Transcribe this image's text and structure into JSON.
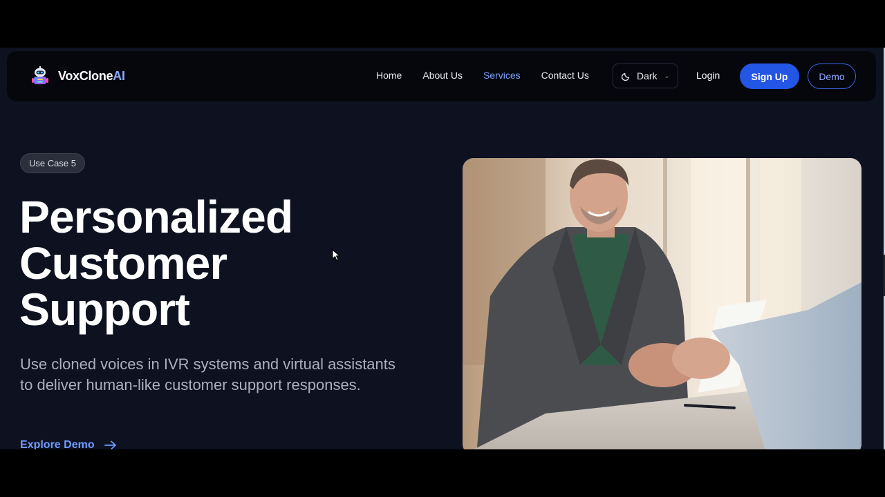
{
  "brand": {
    "name_main": "VoxClone",
    "name_accent": "AI"
  },
  "nav": {
    "links": [
      "Home",
      "About Us",
      "Services",
      "Contact Us"
    ],
    "active": "Services",
    "theme": "Dark",
    "login": "Login",
    "signup": "Sign Up",
    "demo": "Demo"
  },
  "hero": {
    "badge": "Use Case 5",
    "title_line1": "Personalized",
    "title_line2": "Customer",
    "title_line3": "Support",
    "description": "Use cloned voices in IVR systems and virtual assistants to deliver human-like customer support responses.",
    "cta": "Explore Demo"
  },
  "icons": {
    "logo": "robot-logo-icon",
    "theme": "moon-icon",
    "chevron": "chevron-down-icon",
    "cta": "arrow-right-icon"
  },
  "colors": {
    "background": "#0d1120",
    "navbar": "#05070d",
    "accent": "#2456e6",
    "link_active": "#7aa2ff"
  }
}
